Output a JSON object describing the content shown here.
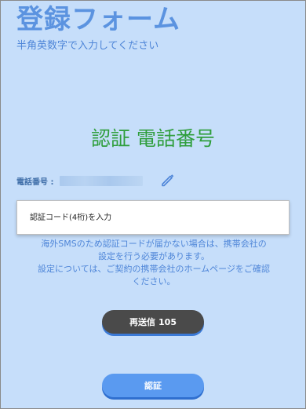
{
  "header": {
    "title": "登録フォーム",
    "subtitle": "半角英数字で入力してください"
  },
  "section": {
    "heading": "認証 電話番号"
  },
  "phone": {
    "label": "電話番号 :",
    "edit_icon": "pencil-icon"
  },
  "code_input": {
    "placeholder": "認証コード(4桁)を入力",
    "value": ""
  },
  "notice": {
    "line1": "海外SMSのため認証コードが届かない場合は、携帯会社の",
    "line2": "設定を行う必要があります。",
    "line3": "設定については、ご契約の携帯会社のホームページをご確認",
    "line4": "ください。"
  },
  "buttons": {
    "resend_label": "再送信",
    "resend_countdown": "105",
    "verify_label": "認証"
  },
  "colors": {
    "background": "#c6defa",
    "title": "#5b93e0",
    "heading": "#2f9e3c",
    "resend_bg": "#4a4a4a",
    "verify_bg": "#5a9af0"
  }
}
